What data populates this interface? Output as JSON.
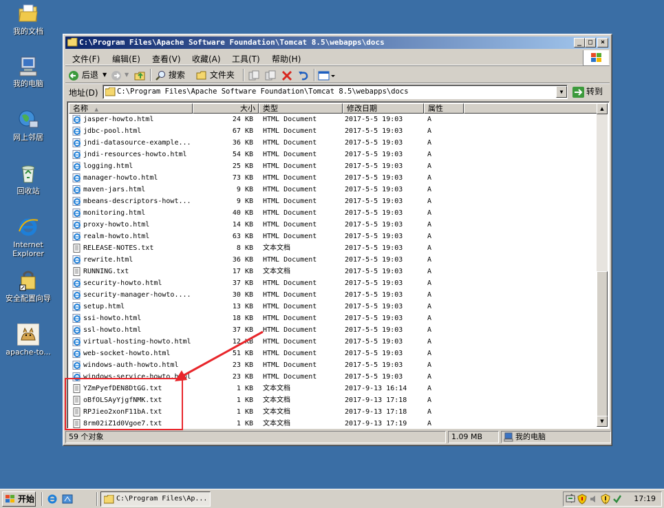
{
  "desktop": {
    "icons": [
      {
        "label": "我的文档"
      },
      {
        "label": "我的电脑"
      },
      {
        "label": "网上邻居"
      },
      {
        "label": "回收站"
      },
      {
        "label": "Internet Explorer"
      },
      {
        "label": "安全配置向导"
      },
      {
        "label": "apache-to..."
      }
    ]
  },
  "window": {
    "title": "C:\\Program Files\\Apache Software Foundation\\Tomcat 8.5\\webapps\\docs",
    "minimize": "_",
    "maximize": "□",
    "close": "×"
  },
  "menubar": {
    "file": "文件(F)",
    "edit": "编辑(E)",
    "view": "查看(V)",
    "favorites": "收藏(A)",
    "tools": "工具(T)",
    "help": "帮助(H)"
  },
  "toolbar": {
    "back": "后退",
    "search": "搜索",
    "folders": "文件夹"
  },
  "addressbar": {
    "label": "地址(D)",
    "value": "C:\\Program Files\\Apache Software Foundation\\Tomcat 8.5\\webapps\\docs",
    "go": "转到"
  },
  "columns": {
    "name": "名称",
    "size": "大小",
    "type": "类型",
    "modified": "修改日期",
    "attributes": "属性"
  },
  "files": [
    {
      "name": "jasper-howto.html",
      "size": "24 KB",
      "type": "HTML Document",
      "modified": "2017-5-5 19:03",
      "attr": "A",
      "kind": "html"
    },
    {
      "name": "jdbc-pool.html",
      "size": "67 KB",
      "type": "HTML Document",
      "modified": "2017-5-5 19:03",
      "attr": "A",
      "kind": "html"
    },
    {
      "name": "jndi-datasource-example...",
      "size": "36 KB",
      "type": "HTML Document",
      "modified": "2017-5-5 19:03",
      "attr": "A",
      "kind": "html"
    },
    {
      "name": "jndi-resources-howto.html",
      "size": "54 KB",
      "type": "HTML Document",
      "modified": "2017-5-5 19:03",
      "attr": "A",
      "kind": "html"
    },
    {
      "name": "logging.html",
      "size": "25 KB",
      "type": "HTML Document",
      "modified": "2017-5-5 19:03",
      "attr": "A",
      "kind": "html"
    },
    {
      "name": "manager-howto.html",
      "size": "73 KB",
      "type": "HTML Document",
      "modified": "2017-5-5 19:03",
      "attr": "A",
      "kind": "html"
    },
    {
      "name": "maven-jars.html",
      "size": "9 KB",
      "type": "HTML Document",
      "modified": "2017-5-5 19:03",
      "attr": "A",
      "kind": "html"
    },
    {
      "name": "mbeans-descriptors-howt...",
      "size": "9 KB",
      "type": "HTML Document",
      "modified": "2017-5-5 19:03",
      "attr": "A",
      "kind": "html"
    },
    {
      "name": "monitoring.html",
      "size": "40 KB",
      "type": "HTML Document",
      "modified": "2017-5-5 19:03",
      "attr": "A",
      "kind": "html"
    },
    {
      "name": "proxy-howto.html",
      "size": "14 KB",
      "type": "HTML Document",
      "modified": "2017-5-5 19:03",
      "attr": "A",
      "kind": "html"
    },
    {
      "name": "realm-howto.html",
      "size": "63 KB",
      "type": "HTML Document",
      "modified": "2017-5-5 19:03",
      "attr": "A",
      "kind": "html"
    },
    {
      "name": "RELEASE-NOTES.txt",
      "size": "8 KB",
      "type": "文本文档",
      "modified": "2017-5-5 19:03",
      "attr": "A",
      "kind": "txt"
    },
    {
      "name": "rewrite.html",
      "size": "36 KB",
      "type": "HTML Document",
      "modified": "2017-5-5 19:03",
      "attr": "A",
      "kind": "html"
    },
    {
      "name": "RUNNING.txt",
      "size": "17 KB",
      "type": "文本文档",
      "modified": "2017-5-5 19:03",
      "attr": "A",
      "kind": "txt"
    },
    {
      "name": "security-howto.html",
      "size": "37 KB",
      "type": "HTML Document",
      "modified": "2017-5-5 19:03",
      "attr": "A",
      "kind": "html"
    },
    {
      "name": "security-manager-howto....",
      "size": "30 KB",
      "type": "HTML Document",
      "modified": "2017-5-5 19:03",
      "attr": "A",
      "kind": "html"
    },
    {
      "name": "setup.html",
      "size": "13 KB",
      "type": "HTML Document",
      "modified": "2017-5-5 19:03",
      "attr": "A",
      "kind": "html"
    },
    {
      "name": "ssi-howto.html",
      "size": "18 KB",
      "type": "HTML Document",
      "modified": "2017-5-5 19:03",
      "attr": "A",
      "kind": "html"
    },
    {
      "name": "ssl-howto.html",
      "size": "37 KB",
      "type": "HTML Document",
      "modified": "2017-5-5 19:03",
      "attr": "A",
      "kind": "html"
    },
    {
      "name": "virtual-hosting-howto.html",
      "size": "12 KB",
      "type": "HTML Document",
      "modified": "2017-5-5 19:03",
      "attr": "A",
      "kind": "html"
    },
    {
      "name": "web-socket-howto.html",
      "size": "51 KB",
      "type": "HTML Document",
      "modified": "2017-5-5 19:03",
      "attr": "A",
      "kind": "html"
    },
    {
      "name": "windows-auth-howto.html",
      "size": "23 KB",
      "type": "HTML Document",
      "modified": "2017-5-5 19:03",
      "attr": "A",
      "kind": "html"
    },
    {
      "name": "windows-service-howto.html",
      "size": "23 KB",
      "type": "HTML Document",
      "modified": "2017-5-5 19:03",
      "attr": "A",
      "kind": "html"
    },
    {
      "name": "YZmPyefDEN8DtGG.txt",
      "size": "1 KB",
      "type": "文本文档",
      "modified": "2017-9-13 16:14",
      "attr": "A",
      "kind": "txt"
    },
    {
      "name": "oBfOLSAyYjgfNMK.txt",
      "size": "1 KB",
      "type": "文本文档",
      "modified": "2017-9-13 17:18",
      "attr": "A",
      "kind": "txt"
    },
    {
      "name": "RPJieo2xonF11bA.txt",
      "size": "1 KB",
      "type": "文本文档",
      "modified": "2017-9-13 17:18",
      "attr": "A",
      "kind": "txt"
    },
    {
      "name": "8rm02iZ1d0Vgoe7.txt",
      "size": "1 KB",
      "type": "文本文档",
      "modified": "2017-9-13 17:19",
      "attr": "A",
      "kind": "txt"
    }
  ],
  "statusbar": {
    "count": "59 个对象",
    "size": "1.09 MB",
    "location": "我的电脑"
  },
  "taskbar": {
    "start": "开始",
    "task": "C:\\Program Files\\Ap...",
    "clock": "17:19"
  },
  "colors": {
    "desktop": "#3a6ea5",
    "titlebar_start": "#0a246a",
    "titlebar_end": "#a6caf0",
    "annotation": "#e8262b"
  }
}
